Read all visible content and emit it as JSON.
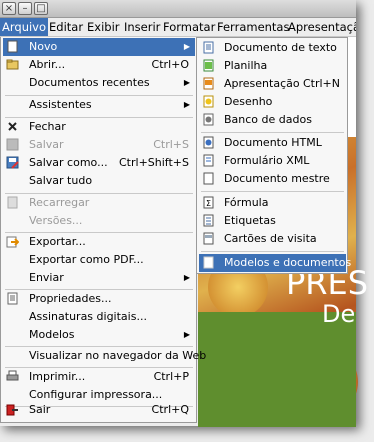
{
  "window": {
    "close": "×",
    "minimize": "–",
    "maximize": "□"
  },
  "menubar": [
    "Arquivo",
    "Editar",
    "Exibir",
    "Inserir",
    "Formatar",
    "Ferramentas",
    "Apresentação"
  ],
  "arquivo_menu": [
    {
      "label": "Novo",
      "icon": "new-document-icon",
      "arrow": "▶",
      "highlight": true
    },
    {
      "label": "Abrir...",
      "icon": "open-folder-icon",
      "shortcut": "Ctrl+O"
    },
    {
      "label": "Documentos recentes",
      "arrow": "▶"
    },
    {
      "label": "Assistentes",
      "arrow": "▶"
    },
    {
      "label": "Fechar",
      "icon": "close-x-icon"
    },
    {
      "label": "Salvar",
      "icon": "save-icon",
      "shortcut": "Ctrl+S",
      "disabled": true
    },
    {
      "label": "Salvar como...",
      "icon": "save-as-icon",
      "shortcut": "Ctrl+Shift+S"
    },
    {
      "label": "Salvar tudo"
    },
    {
      "label": "Recarregar",
      "icon": "reload-icon",
      "disabled": true
    },
    {
      "label": "Versões...",
      "disabled": true
    },
    {
      "label": "Exportar...",
      "icon": "export-icon"
    },
    {
      "label": "Exportar como PDF..."
    },
    {
      "label": "Enviar",
      "arrow": "▶"
    },
    {
      "label": "Propriedades...",
      "icon": "properties-icon"
    },
    {
      "label": "Assinaturas digitais..."
    },
    {
      "label": "Modelos",
      "arrow": "▶"
    },
    {
      "label": "Visualizar no navegador da Web"
    },
    {
      "label": "Imprimir...",
      "icon": "printer-icon",
      "shortcut": "Ctrl+P"
    },
    {
      "label": "Configurar impressora..."
    },
    {
      "label": "Sair",
      "icon": "exit-icon",
      "shortcut": "Ctrl+Q"
    }
  ],
  "novo_submenu": [
    {
      "label": "Documento de texto",
      "icon": "text-document-icon"
    },
    {
      "label": "Planilha",
      "icon": "spreadsheet-icon"
    },
    {
      "label": "Apresentação",
      "icon": "presentation-icon",
      "shortcut": "Ctrl+N"
    },
    {
      "label": "Desenho",
      "icon": "drawing-icon"
    },
    {
      "label": "Banco de dados",
      "icon": "database-icon"
    },
    {
      "label": "Documento HTML",
      "icon": "html-document-icon"
    },
    {
      "label": "Formulário XML",
      "icon": "xml-form-icon"
    },
    {
      "label": "Documento mestre",
      "icon": "master-document-icon"
    },
    {
      "label": "Fórmula",
      "icon": "formula-icon"
    },
    {
      "label": "Etiquetas",
      "icon": "labels-icon"
    },
    {
      "label": "Cartões de visita",
      "icon": "business-cards-icon"
    },
    {
      "label": "Modelos e documentos",
      "icon": "templates-icon",
      "highlight": true
    }
  ],
  "background": {
    "line1": "PRES",
    "line2": "De"
  },
  "colors": {
    "highlight": "#3d71b6"
  }
}
